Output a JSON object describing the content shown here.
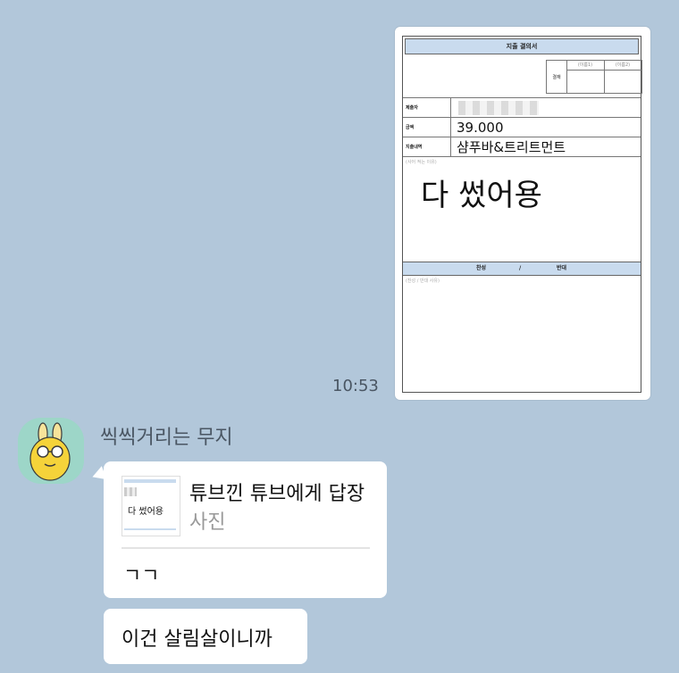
{
  "photo": {
    "form_title": "지출 결의서",
    "approval_label": "결재",
    "approver1": "(이름1)",
    "approver2": "(이름2)",
    "rows": [
      {
        "label": "제출자",
        "value": ""
      },
      {
        "label": "금액",
        "value": "39.000"
      },
      {
        "label": "지출내역",
        "value": "샴푸바&트리트먼트"
      }
    ],
    "reason_hint": "(사어 적는 이유)",
    "handwritten": "다 썼어용",
    "vote_for": "찬성",
    "vote_sep": "/",
    "vote_against": "반대",
    "vote_hint": "(찬성 / 반대 사유)"
  },
  "sent_time": "10:53",
  "sender_name": "씩씩거리는 무지",
  "reply": {
    "title": "튜브낀 튜브에게 답장",
    "subtitle": "사진",
    "message": "ㄱㄱ"
  },
  "message2": "이건 살림살이니까",
  "colors": {
    "background": "#b2c7da",
    "bubble": "#ffffff",
    "form_header": "#c9dbee",
    "avatar_bg": "#9dd6c8"
  }
}
